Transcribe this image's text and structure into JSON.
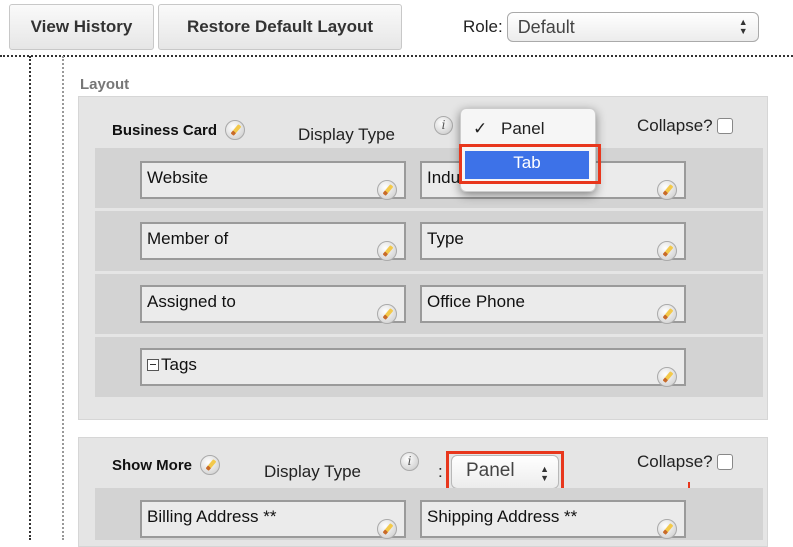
{
  "toolbar": {
    "view_history": "View History",
    "restore_default": "Restore Default Layout",
    "role_label": "Role:",
    "role_value": "Default"
  },
  "layout_label": "Layout",
  "panels": [
    {
      "title": "Business Card",
      "display_type_label": "Display Type",
      "collapse_label": "Collapse?",
      "rows": [
        [
          "Website",
          "Industry"
        ],
        [
          "Member of",
          "Type"
        ],
        [
          "Assigned to",
          "Office Phone"
        ],
        [
          "Tags"
        ]
      ]
    },
    {
      "title": "Show More",
      "display_type_label": "Display Type",
      "display_type_sep": ":",
      "display_type_value": "Panel",
      "collapse_label": "Collapse?",
      "rows": [
        [
          "Billing Address **",
          "Shipping Address **"
        ]
      ]
    }
  ],
  "dropdown": {
    "options": [
      "Panel",
      "Tab"
    ],
    "checked": "Panel",
    "highlighted": "Tab",
    "check_mark": "✓"
  },
  "colors": {
    "highlight_border": "#e8371d",
    "selected_option": "#3d72e8",
    "panel_bg": "#e5e5e5"
  }
}
